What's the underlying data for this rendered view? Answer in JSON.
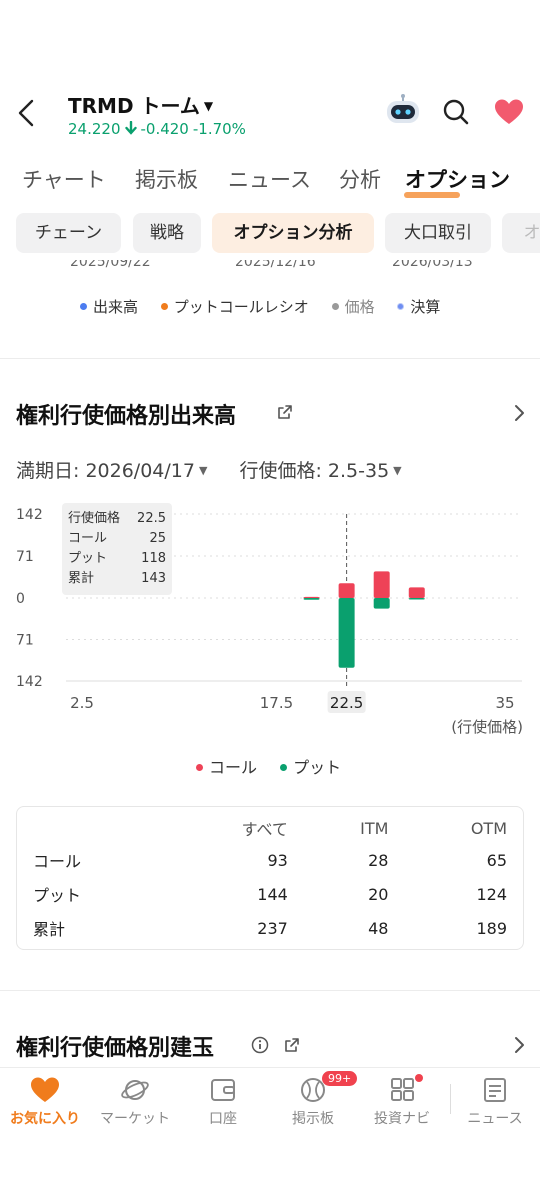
{
  "header": {
    "ticker": "TRMD トーム",
    "price": "24.220",
    "change": "-0.420",
    "change_pct": "-1.70%",
    "up_color": "#0aa06e",
    "heart_color": "#f25a6e"
  },
  "tabs": [
    {
      "label": "チャート"
    },
    {
      "label": "掲示板"
    },
    {
      "label": "ニュース"
    },
    {
      "label": "分析"
    },
    {
      "label": "オプション",
      "active": true
    }
  ],
  "chips": [
    {
      "label": "チェーン"
    },
    {
      "label": "戦略"
    },
    {
      "label": "オプション分析",
      "active": true
    },
    {
      "label": "大口取引"
    },
    {
      "label": "オ"
    }
  ],
  "prev_chart": {
    "dates": [
      "2025/09/22",
      "2025/12/16",
      "2026/03/13"
    ],
    "legend": [
      {
        "label": "出来高",
        "color": "#4c7cf0"
      },
      {
        "label": "プットコールレシオ",
        "color": "#f07c1d"
      },
      {
        "label": "価格",
        "color": "#9a9a9a"
      },
      {
        "label": "決算",
        "color": "#6f8ef2"
      }
    ]
  },
  "volume_section": {
    "title": "権利行使価格別出来高",
    "expiry_label": "満期日: 2026/04/17",
    "strike_label": "行使価格: 2.5-35",
    "x_unit": "(行使価格)",
    "tooltip": {
      "rows": [
        {
          "label": "行使価格",
          "value": "22.5"
        },
        {
          "label": "コール",
          "value": "25"
        },
        {
          "label": "プット",
          "value": "118"
        },
        {
          "label": "累計",
          "value": "143"
        }
      ]
    },
    "legend": [
      {
        "label": "コール",
        "color": "#ee4257"
      },
      {
        "label": "プット",
        "color": "#0aa06e"
      }
    ]
  },
  "chart_data": {
    "type": "bar",
    "y_tick_labels": [
      "142",
      "71",
      "0",
      "71",
      "142"
    ],
    "ylim": [
      -142,
      142
    ],
    "x_tick_labels": [
      "2.5",
      "17.5",
      "22.5",
      "35"
    ],
    "xlim": [
      2.5,
      35
    ],
    "highlight_strike": 22.5,
    "grid": true,
    "series": [
      {
        "name": "コール",
        "color": "#ee4257",
        "x": [
          20,
          22.5,
          25,
          27.5
        ],
        "values": [
          2,
          25,
          45,
          18
        ]
      },
      {
        "name": "プット",
        "color": "#0aa06e",
        "x": [
          20,
          22.5,
          25,
          27.5
        ],
        "values": [
          3,
          118,
          18,
          2
        ]
      }
    ]
  },
  "summary_table": {
    "headers": [
      "",
      "すべて",
      "ITM",
      "OTM"
    ],
    "rows": [
      [
        "コール",
        "93",
        "28",
        "65"
      ],
      [
        "プット",
        "144",
        "20",
        "124"
      ],
      [
        "累計",
        "237",
        "48",
        "189"
      ]
    ]
  },
  "oi_section": {
    "title": "権利行使価格別建玉"
  },
  "bottom_nav": [
    {
      "label": "お気に入り",
      "active": true
    },
    {
      "label": "マーケット"
    },
    {
      "label": "口座"
    },
    {
      "label": "掲示板",
      "badge": "99+"
    },
    {
      "label": "投資ナビ",
      "dot": true
    },
    {
      "label": "ニュース"
    }
  ]
}
